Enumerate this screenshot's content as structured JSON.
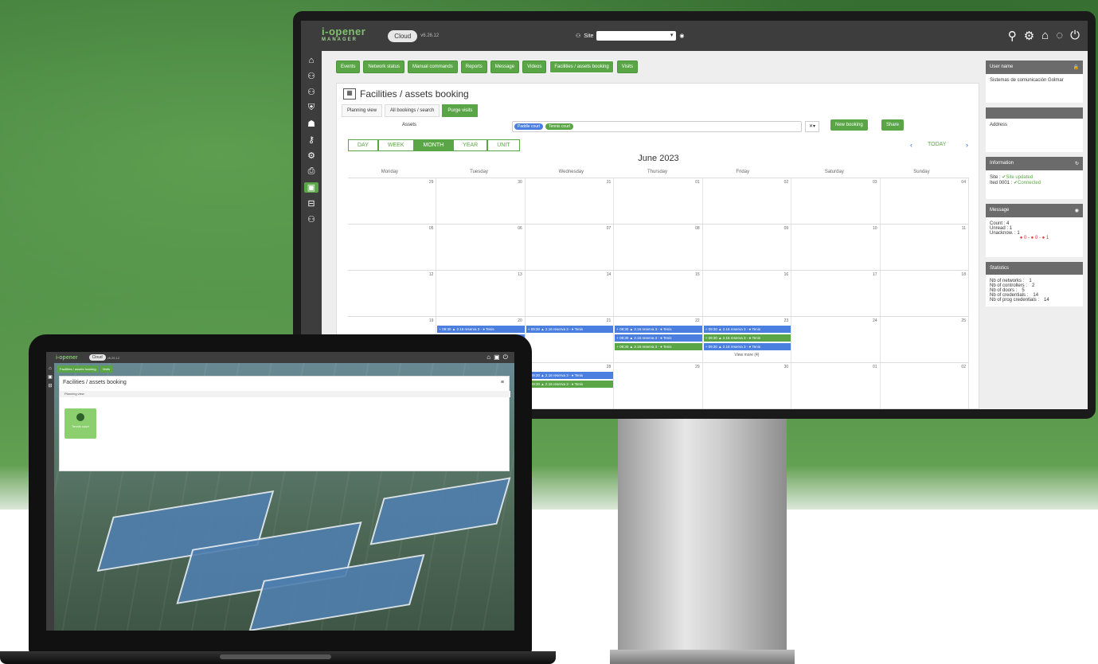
{
  "monitor": {
    "app": {
      "logo": "i-opener",
      "logo_sub": "MANAGER",
      "cloud": "Cloud",
      "version": "v6.26.12"
    },
    "site_label": "Site",
    "left_nav": [
      "home-icon",
      "network-icon",
      "devices-icon",
      "shield-icon",
      "users-icon",
      "access-icon",
      "settings-icon",
      "print-icon",
      "booking-icon",
      "briefcase-icon",
      "sites-icon"
    ],
    "modules": [
      "Events",
      "Network status",
      "Manual commands",
      "Reports",
      "Message",
      "Videos",
      "Facilities / assets booking",
      "Visits"
    ],
    "page_title": "Facilities / assets booking",
    "tabs": [
      "Planning view",
      "All bookings / search",
      "Purge visits"
    ],
    "assets_label": "Assets",
    "asset_chips": [
      "Paddle court",
      "Tennis court"
    ],
    "new_booking": "New booking",
    "share": "Share",
    "views": [
      "DAY",
      "WEEK",
      "MONTH",
      "YEAR",
      "UNIT"
    ],
    "selected_view": "MONTH",
    "today": "TODAY",
    "month_title": "June 2023",
    "days": [
      "Monday",
      "Tuesday",
      "Wednesday",
      "Thursday",
      "Friday",
      "Saturday",
      "Sunday"
    ],
    "weeks": [
      [
        "29",
        "30",
        "31",
        "01",
        "02",
        "03",
        "04"
      ],
      [
        "05",
        "06",
        "07",
        "08",
        "09",
        "10",
        "11"
      ],
      [
        "12",
        "13",
        "14",
        "15",
        "16",
        "17",
        "18"
      ],
      [
        "19",
        "20",
        "21",
        "22",
        "23",
        "24",
        "25"
      ],
      [
        "26",
        "27",
        "28",
        "29",
        "30",
        "01",
        "02"
      ]
    ],
    "event_text": "+ 09:30 ▲ 2.16 reserva 3 - ● Tenis",
    "view_more": "View more (4)",
    "sidebar": {
      "user_header": "User name",
      "user_flag": "ES",
      "user_org": "Sistemas de comunicación Golmar",
      "address_label": "Address",
      "info_header": "Information",
      "info_rows": [
        [
          "Site :",
          "✔Site updated"
        ],
        [
          "Ited 0001 :",
          "✔Connected"
        ]
      ],
      "message_header": "Message",
      "message_rows": [
        [
          "Count :",
          "4"
        ],
        [
          "Unread :",
          "1"
        ],
        [
          "Unacknow. :",
          "1"
        ]
      ],
      "message_counts": "● 0 - ● 0 - ● 1",
      "stats_header": "Statistics",
      "stats_rows": [
        [
          "Nb of networks :",
          "1"
        ],
        [
          "Nb of controllers :",
          "2"
        ],
        [
          "Nb of doors :",
          "5"
        ],
        [
          "Nb of credentials :",
          "14"
        ],
        [
          "Nb of prog credentials :",
          "14"
        ]
      ]
    }
  },
  "laptop": {
    "logo": "i-opener",
    "cloud": "Cloud",
    "version": "v6.26.12",
    "modules": [
      "Facilities / assets booking",
      "Visits"
    ],
    "page_title": "Facilities / assets booking",
    "subtab": "Planning view",
    "tile_label": "Tennis court"
  },
  "colors": {
    "accent_green": "#5aa646",
    "event_blue": "#4a7fe0",
    "bar_dark": "#3d3d3d"
  }
}
